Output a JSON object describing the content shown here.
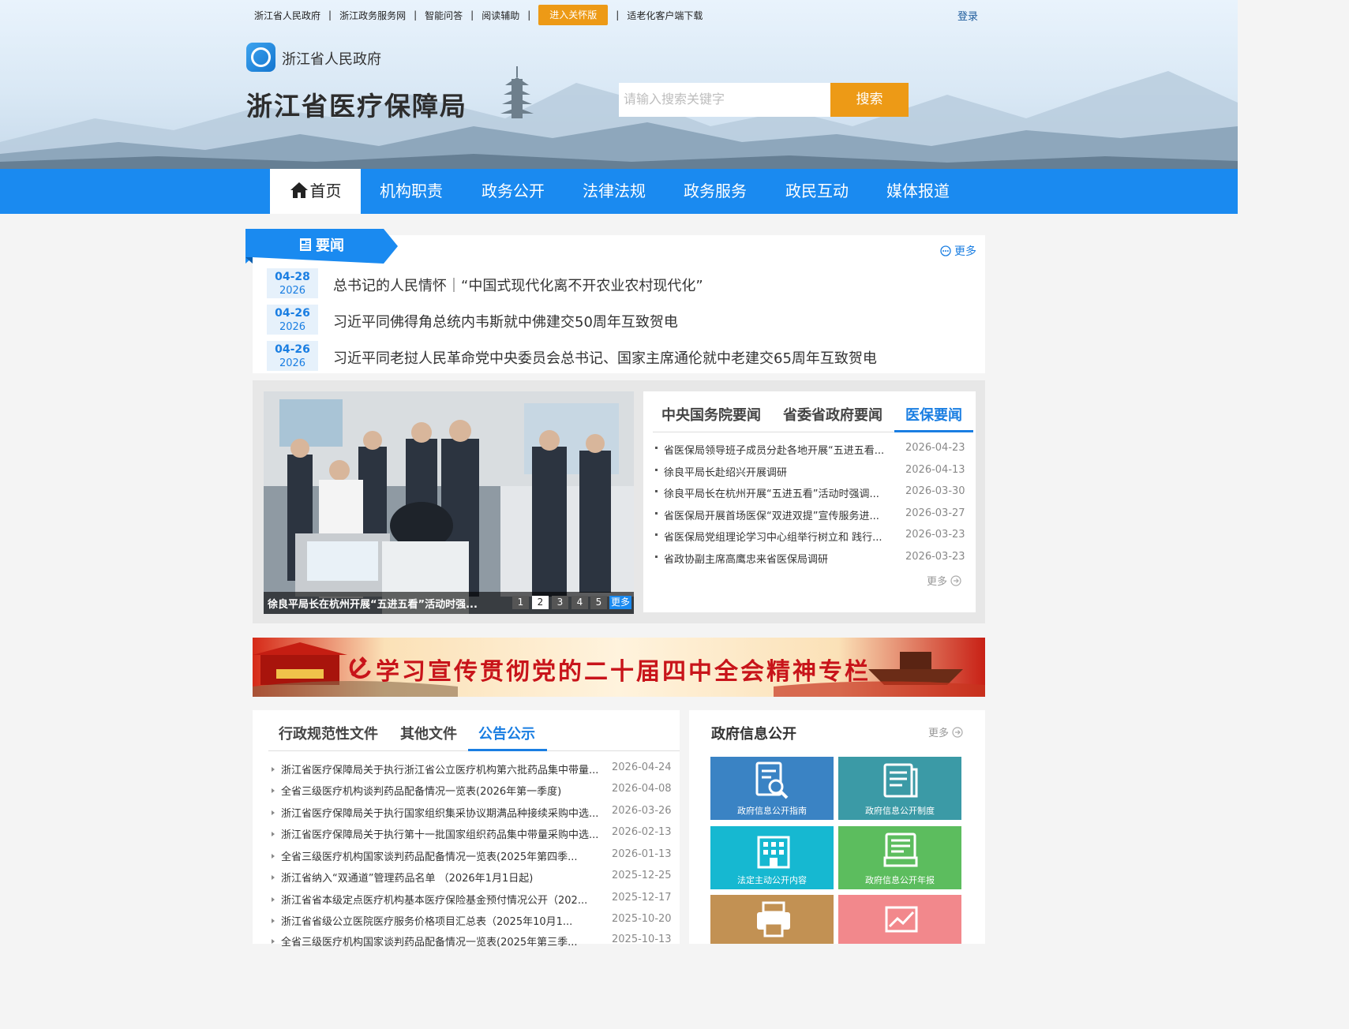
{
  "header": {
    "top_links": [
      "浙江省人民政府",
      "浙江政务服务网",
      "智能问答",
      "阅读辅助"
    ],
    "care_button": "进入关怀版",
    "app_download": "适老化客户端下载",
    "login": "登录",
    "gov_name": "浙江省人民政府",
    "bureau_name": "浙江省医疗保障局",
    "search_placeholder": "请输入搜索关键字",
    "search_button": "搜索"
  },
  "nav": {
    "items": [
      "首页",
      "机构职责",
      "政务公开",
      "法律法规",
      "政务服务",
      "政民互动",
      "媒体报道"
    ],
    "active": "首页"
  },
  "news": {
    "label": "要闻",
    "more": "更多",
    "items": [
      {
        "md": "04-28",
        "year": "2026",
        "title": "总书记的人民情怀｜“中国式现代化离不开农业农村现代化”"
      },
      {
        "md": "04-26",
        "year": "2026",
        "title": "习近平同佛得角总统内韦斯就中佛建交50周年互致贺电"
      },
      {
        "md": "04-26",
        "year": "2026",
        "title": "习近平同老挝人民革命党中央委员会总书记、国家主席通伦就中老建交65周年互致贺电"
      }
    ]
  },
  "carousel": {
    "caption": "徐良平局长在杭州开展“五进五看”活动时强...",
    "pages": [
      "1",
      "2",
      "3",
      "4",
      "5"
    ],
    "active_page": "2",
    "more": "更多"
  },
  "news_tabs": {
    "tabs": [
      "中央国务院要闻",
      "省委省政府要闻",
      "医保要闻"
    ],
    "active": "医保要闻",
    "items": [
      {
        "title": "省医保局领导班子成员分赴各地开展“五进五看...",
        "date": "2026-04-23"
      },
      {
        "title": "徐良平局长赴绍兴开展调研",
        "date": "2026-04-13"
      },
      {
        "title": "徐良平局长在杭州开展“五进五看”活动时强调...",
        "date": "2026-03-30"
      },
      {
        "title": "省医保局开展首场医保“双进双提”宣传服务进...",
        "date": "2026-03-27"
      },
      {
        "title": "省医保局党组理论学习中心组举行树立和 践行...",
        "date": "2026-03-23"
      },
      {
        "title": "省政协副主席高鹰忠来省医保局调研",
        "date": "2026-03-23"
      }
    ],
    "more": "更多"
  },
  "special_banner": {
    "text": "学习宣传贯彻党的二十届四中全会精神专栏"
  },
  "docs": {
    "tabs": [
      "行政规范性文件",
      "其他文件",
      "公告公示"
    ],
    "active": "公告公示",
    "items": [
      {
        "title": "浙江省医疗保障局关于执行浙江省公立医疗机构第六批药品集中带量...",
        "date": "2026-04-24"
      },
      {
        "title": "全省三级医疗机构谈判药品配备情况一览表(2026年第一季度)",
        "date": "2026-04-08"
      },
      {
        "title": "浙江省医疗保障局关于执行国家组织集采协议期满品种接续采购中选...",
        "date": "2026-03-26"
      },
      {
        "title": "浙江省医疗保障局关于执行第十一批国家组织药品集中带量采购中选...",
        "date": "2026-02-13"
      },
      {
        "title": "全省三级医疗机构国家谈判药品配备情况一览表(2025年第四季...",
        "date": "2026-01-13"
      },
      {
        "title": "浙江省纳入“双通道”管理药品名单 （2026年1月1日起)",
        "date": "2025-12-25"
      },
      {
        "title": "浙江省省本级定点医疗机构基本医疗保险基金预付情况公开（202...",
        "date": "2025-12-17"
      },
      {
        "title": "浙江省省级公立医院医疗服务价格项目汇总表（2025年10月1...",
        "date": "2025-10-20"
      },
      {
        "title": "全省三级医疗机构国家谈判药品配备情况一览表(2025年第三季...",
        "date": "2025-10-13"
      }
    ]
  },
  "gov_info": {
    "title": "政府信息公开",
    "more": "更多",
    "tiles": [
      {
        "label": "政府信息公开指南",
        "color": "#3a83c4",
        "icon": "document-search-icon"
      },
      {
        "label": "政府信息公开制度",
        "color": "#3b9aa6",
        "icon": "document-list-icon"
      },
      {
        "label": "法定主动公开内容",
        "color": "#16b8d1",
        "icon": "building-icon"
      },
      {
        "label": "政府信息公开年报",
        "color": "#5cbd5e",
        "icon": "report-icon"
      },
      {
        "label": "",
        "color": "#c29153",
        "icon": "printer-icon"
      },
      {
        "label": "",
        "color": "#f2888c",
        "icon": "chart-icon"
      }
    ]
  }
}
